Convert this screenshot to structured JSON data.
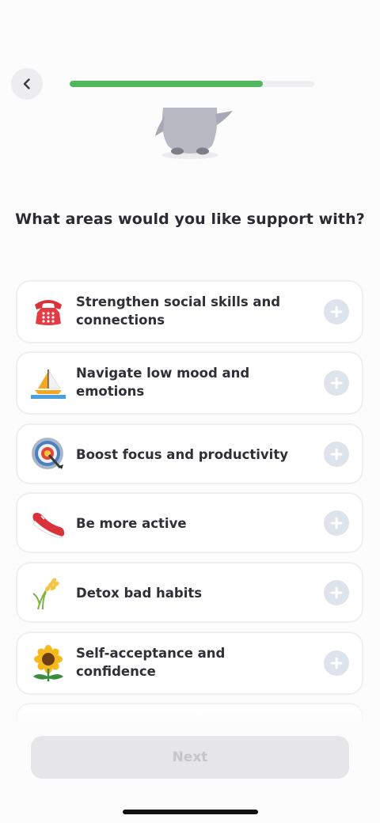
{
  "header": {
    "progress": 0.79
  },
  "question": {
    "title": "What areas would you like support with?"
  },
  "options": [
    {
      "label_line1": "Strengthen social skills and",
      "label_line2": "connections",
      "icon": "telephone-icon"
    },
    {
      "label_line1": "Navigate low mood and",
      "label_line2": "emotions",
      "icon": "sailboat-icon"
    },
    {
      "label_line1": "Boost focus and productivity",
      "icon": "target-icon"
    },
    {
      "label_line1": "Be more active",
      "icon": "sneaker-icon"
    },
    {
      "label_line1": "Detox bad habits",
      "icon": "wheat-icon"
    },
    {
      "label_line1": "Self-acceptance and",
      "label_line2": "confidence",
      "icon": "sunflower-icon"
    }
  ],
  "footer": {
    "next_label": "Next"
  },
  "colors": {
    "accent_green": "#50b75e",
    "plus_bg": "#dde4ec",
    "disabled_button": "#e6e6e9"
  }
}
